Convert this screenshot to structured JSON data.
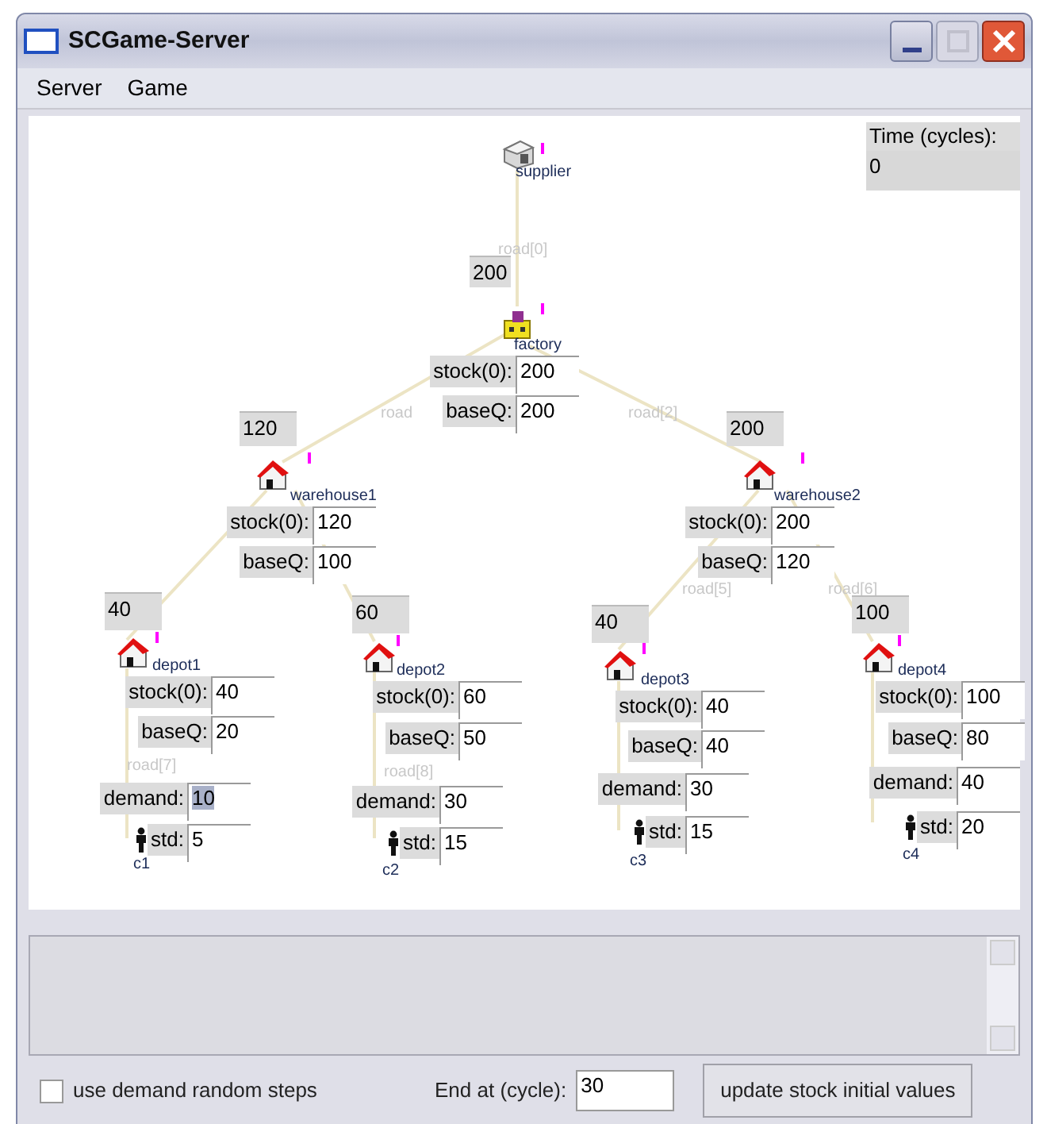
{
  "window": {
    "title": "SCGame-Server"
  },
  "menu": [
    "Server",
    "Game"
  ],
  "time": {
    "label": "Time (cycles):",
    "value": "0"
  },
  "roads": [
    "road[0]",
    "road",
    "road[2]",
    "road[7]",
    "road[8]",
    "road[5]",
    "road[6]"
  ],
  "nodes": [
    {
      "kind": "supplier",
      "name": "supplier"
    },
    {
      "kind": "factory",
      "name": "factory",
      "order": "200",
      "fields": [
        {
          "label": "stock(0):",
          "value": "200"
        },
        {
          "label": "baseQ:",
          "value": "200"
        }
      ]
    },
    {
      "kind": "warehouse",
      "name": "warehouse1",
      "order": "120",
      "fields": [
        {
          "label": "stock(0):",
          "value": "120"
        },
        {
          "label": "baseQ:",
          "value": "100"
        }
      ]
    },
    {
      "kind": "warehouse",
      "name": "warehouse2",
      "order": "200",
      "fields": [
        {
          "label": "stock(0):",
          "value": "200"
        },
        {
          "label": "baseQ:",
          "value": "120"
        }
      ]
    },
    {
      "kind": "depot",
      "name": "depot1",
      "order": "40",
      "fields": [
        {
          "label": "stock(0):",
          "value": "40"
        },
        {
          "label": "baseQ:",
          "value": "20"
        }
      ],
      "customer": {
        "name": "c1",
        "demand": {
          "label": "demand:",
          "value": "10",
          "highlighted": true
        },
        "std": {
          "label": "std:",
          "value": "5"
        }
      }
    },
    {
      "kind": "depot",
      "name": "depot2",
      "order": "60",
      "fields": [
        {
          "label": "stock(0):",
          "value": "60"
        },
        {
          "label": "baseQ:",
          "value": "50"
        }
      ],
      "customer": {
        "name": "c2",
        "demand": {
          "label": "demand:",
          "value": "30",
          "highlighted": false
        },
        "std": {
          "label": "std:",
          "value": "15"
        }
      }
    },
    {
      "kind": "depot",
      "name": "depot3",
      "order": "40",
      "fields": [
        {
          "label": "stock(0):",
          "value": "40"
        },
        {
          "label": "baseQ:",
          "value": "40"
        }
      ],
      "customer": {
        "name": "c3",
        "demand": {
          "label": "demand:",
          "value": "30",
          "highlighted": false
        },
        "std": {
          "label": "std:",
          "value": "15"
        }
      }
    },
    {
      "kind": "depot",
      "name": "depot4",
      "order": "100",
      "fields": [
        {
          "label": "stock(0):",
          "value": "100"
        },
        {
          "label": "baseQ:",
          "value": "80"
        }
      ],
      "customer": {
        "name": "c4",
        "demand": {
          "label": "demand:",
          "value": "40",
          "highlighted": false
        },
        "std": {
          "label": "std:",
          "value": "20"
        }
      }
    }
  ],
  "random_steps": {
    "label": "use demand random steps",
    "checked": false
  },
  "end_at": {
    "label": "End at (cycle):",
    "value": "30"
  },
  "update_button": "update stock initial values"
}
